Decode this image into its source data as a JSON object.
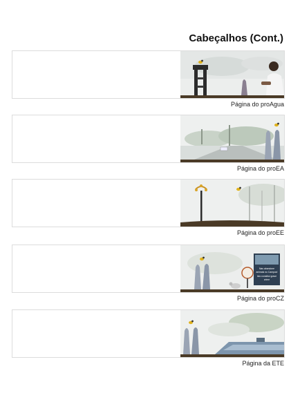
{
  "page": {
    "title": "Cabeçalhos (Cont.)"
  },
  "headers": [
    {
      "caption": "Página do proAgua",
      "scene": "tower-person"
    },
    {
      "caption": "Página do proEA",
      "scene": "trees-road"
    },
    {
      "caption": "Página do proEE",
      "scene": "lamp-poles"
    },
    {
      "caption": "Página do proCZ",
      "scene": "signs-cat"
    },
    {
      "caption": "Página da ETE",
      "scene": "water-sculpture"
    }
  ],
  "sign_text": {
    "line1": "Nas abandone",
    "line2": "animais no Campus!",
    "line3": "Isto constitui grave",
    "line4": "crime"
  },
  "colors": {
    "ground": "#4a3a26",
    "sky": "#e9ecec",
    "bird": "#e0b21e",
    "tower": "#2b2b2b"
  }
}
